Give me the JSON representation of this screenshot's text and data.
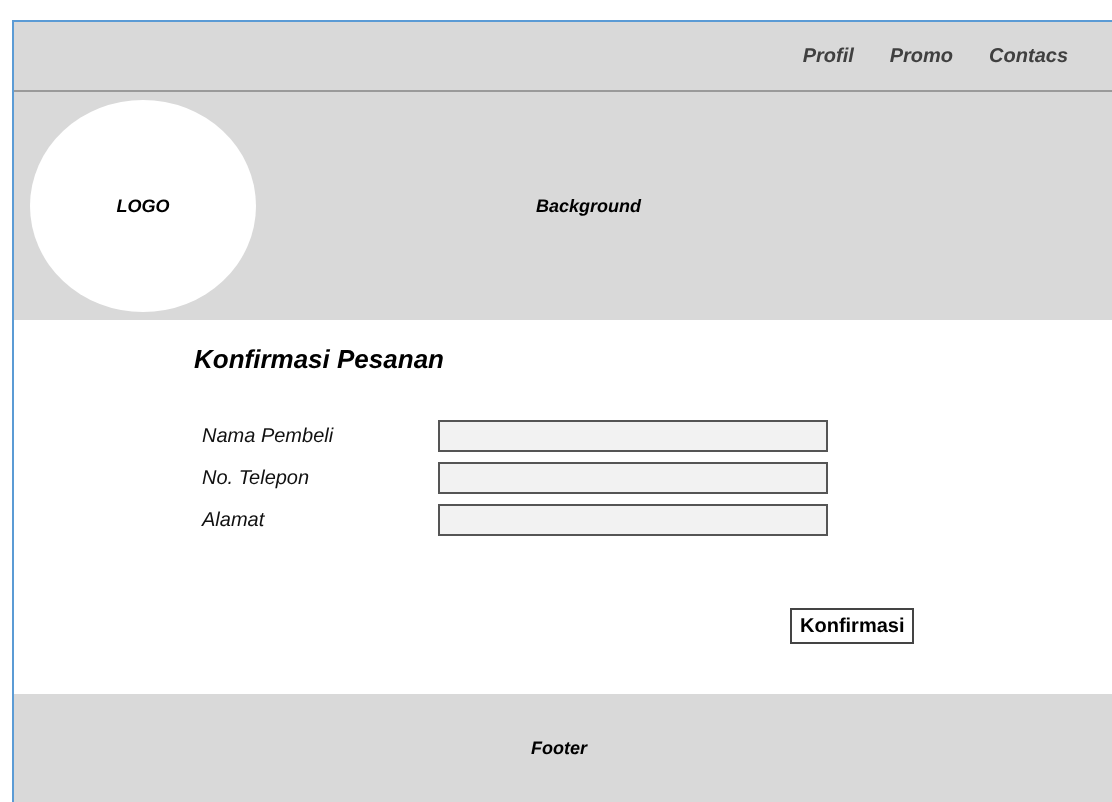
{
  "nav": {
    "links": [
      "Profil",
      "Promo",
      "Contacs"
    ]
  },
  "header": {
    "logo": "LOGO",
    "background": "Background"
  },
  "form": {
    "title": "Konfirmasi Pesanan",
    "fields": [
      {
        "label": "Nama Pembeli"
      },
      {
        "label": "No.  Telepon"
      },
      {
        "label": "Alamat"
      }
    ],
    "button": "Konfirmasi"
  },
  "footer": {
    "text": "Footer"
  }
}
